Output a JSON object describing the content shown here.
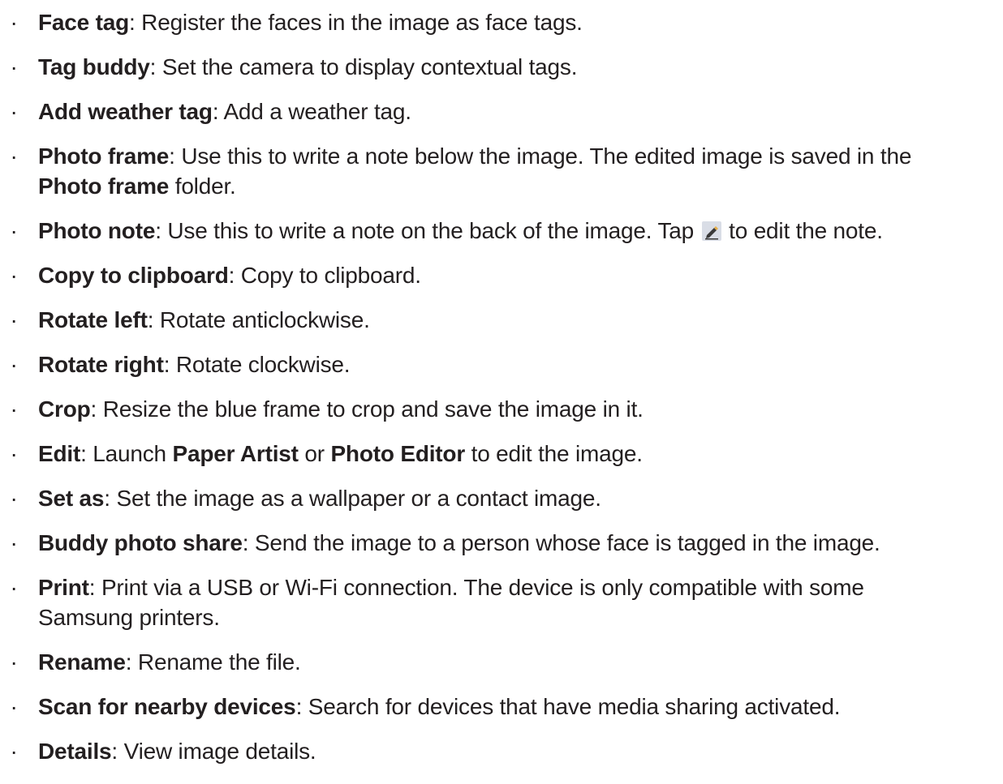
{
  "bullet": "·",
  "items": [
    {
      "term": "Face tag",
      "sep": ": ",
      "desc": "Register the faces in the image as face tags."
    },
    {
      "term": "Tag buddy",
      "sep": ": ",
      "desc": "Set the camera to display contextual tags."
    },
    {
      "term": "Add weather tag",
      "sep": ": ",
      "desc": "Add a weather tag."
    },
    {
      "term": "Photo frame",
      "sep": ": ",
      "desc": "Use this to write a note below the image. The edited image is saved in the",
      "line2_bold": "Photo frame",
      "line2_rest": " folder."
    },
    {
      "term": "Photo note",
      "sep": ": ",
      "desc_before_icon": "Use this to write a note on the back of the image. Tap ",
      "icon": "edit-pencil-icon",
      "desc_after_icon": " to edit the note."
    },
    {
      "term": "Copy to clipboard",
      "sep": ": ",
      "desc": "Copy to clipboard."
    },
    {
      "term": "Rotate left",
      "sep": ": ",
      "desc": "Rotate anticlockwise."
    },
    {
      "term": "Rotate right",
      "sep": ": ",
      "desc": "Rotate clockwise."
    },
    {
      "term": "Crop",
      "sep": ": ",
      "desc": "Resize the blue frame to crop and save the image in it."
    },
    {
      "term": "Edit",
      "sep": ": ",
      "desc_1": "Launch ",
      "bold_1": "Paper Artist",
      "desc_2": " or ",
      "bold_2": "Photo Editor",
      "desc_3": " to edit the image."
    },
    {
      "term": "Set as",
      "sep": ": ",
      "desc": "Set the image as a wallpaper or a contact image."
    },
    {
      "term": "Buddy photo share",
      "sep": ": ",
      "desc": "Send the image to a person whose face is tagged in the image."
    },
    {
      "term": "Print",
      "sep": ": ",
      "desc": "Print via a USB or Wi-Fi connection. The device is only compatible with some",
      "line2": "Samsung printers."
    },
    {
      "term": "Rename",
      "sep": ": ",
      "desc": "Rename the file."
    },
    {
      "term": "Scan for nearby devices",
      "sep": ": ",
      "desc": "Search for devices that have media sharing activated."
    },
    {
      "term": "Details",
      "sep": ": ",
      "desc": "View image details."
    }
  ],
  "colors": {
    "text": "#231f20",
    "icon_bg": "#d9dde6",
    "icon_pencil": "#3a3a3a",
    "icon_accent": "#e8b04a"
  }
}
